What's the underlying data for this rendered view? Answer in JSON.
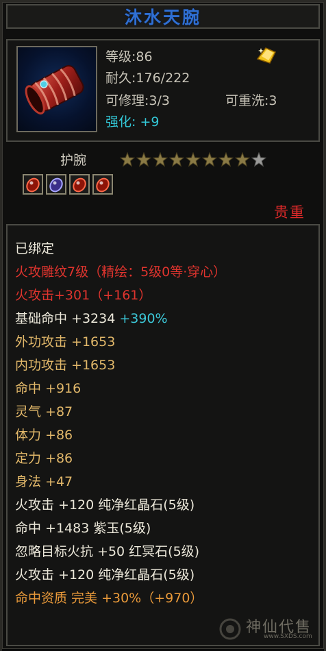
{
  "title": "沐水天腕",
  "stats": {
    "level_label": "等级:",
    "level_value": "86",
    "durability_label": "耐久:",
    "durability_value": "176/222",
    "repair_label": "可修理:",
    "repair_value": "3/3",
    "rewash_label": "可重洗:",
    "rewash_value": "3",
    "enhance_label": "强化:",
    "enhance_value": "+9"
  },
  "item_type": "护腕",
  "stars": {
    "total": 9,
    "filled": 8
  },
  "gems": [
    "red-gem-icon",
    "purple-gem-icon",
    "red-gem-icon",
    "red-gem-icon"
  ],
  "rarity": "贵重",
  "attributes": [
    {
      "segments": [
        {
          "text": "已绑定",
          "color": "white"
        }
      ]
    },
    {
      "segments": [
        {
          "text": "火攻雕纹7级（精绘：5级0等·穿心）",
          "color": "red"
        }
      ]
    },
    {
      "segments": [
        {
          "text": "火攻击+301（+161）",
          "color": "red"
        }
      ]
    },
    {
      "segments": [
        {
          "text": "基础命中 +3234 ",
          "color": "white"
        },
        {
          "text": "+390%",
          "color": "cyan"
        }
      ]
    },
    {
      "segments": [
        {
          "text": "外功攻击 +1653",
          "color": "gold"
        }
      ]
    },
    {
      "segments": [
        {
          "text": "内功攻击 +1653",
          "color": "gold"
        }
      ]
    },
    {
      "segments": [
        {
          "text": "命中 +916",
          "color": "gold"
        }
      ]
    },
    {
      "segments": [
        {
          "text": "灵气 +87",
          "color": "gold"
        }
      ]
    },
    {
      "segments": [
        {
          "text": "体力 +86",
          "color": "gold"
        }
      ]
    },
    {
      "segments": [
        {
          "text": "定力 +86",
          "color": "gold"
        }
      ]
    },
    {
      "segments": [
        {
          "text": "身法 +47",
          "color": "gold"
        }
      ]
    },
    {
      "segments": [
        {
          "text": "火攻击 +120 纯净红晶石(5级)",
          "color": "white"
        }
      ]
    },
    {
      "segments": [
        {
          "text": "命中 +1483 紫玉(5级)",
          "color": "white"
        }
      ]
    },
    {
      "segments": [
        {
          "text": "忽略目标火抗 +50 红冥石(5级)",
          "color": "white"
        }
      ]
    },
    {
      "segments": [
        {
          "text": "火攻击 +120 纯净红晶石(5级)",
          "color": "white"
        }
      ]
    },
    {
      "segments": [
        {
          "text": "命中资质  完美 +30%（+970）",
          "color": "orange"
        }
      ]
    }
  ],
  "watermark": {
    "text": "神仙代售",
    "url": "www.SXDS.com"
  },
  "colors": {
    "title": "#2f6fd3",
    "white": "#ece8da",
    "red": "#e0342e",
    "gold": "#e2b86a",
    "orange": "#ea9a3a",
    "cyan": "#3cc8d8",
    "rarity": "#e02a2a"
  }
}
